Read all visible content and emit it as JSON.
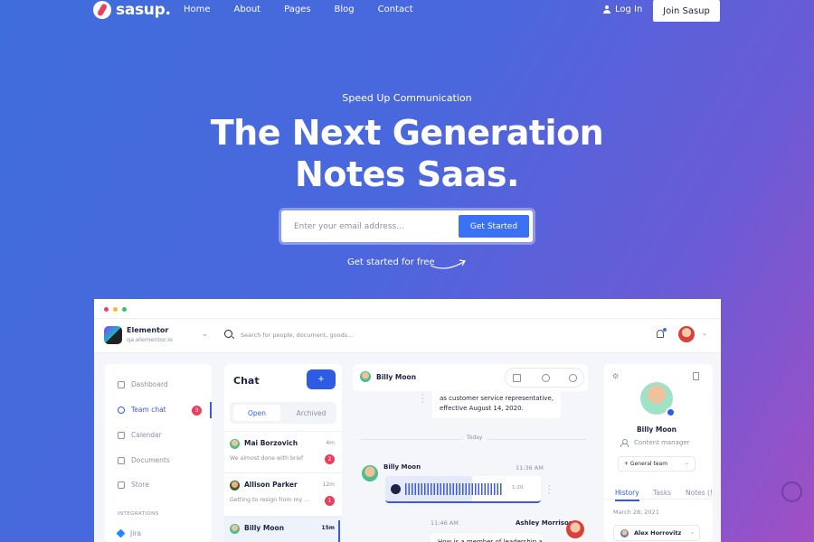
{
  "brand": {
    "name": "sasup."
  },
  "nav": {
    "links": [
      "Home",
      "About",
      "Pages",
      "Blog",
      "Contact"
    ],
    "login": "Log In",
    "join": "Join Sasup"
  },
  "hero": {
    "kicker": "Speed Up Communication",
    "headline_line1": "The Next Generation",
    "headline_line2": "Notes Saas.",
    "email_placeholder": "Enter your email address...",
    "cta": "Get Started",
    "free_text": "Get started for free"
  },
  "app": {
    "workspace": {
      "name": "Elementor",
      "sub": "qa.elementor.io"
    },
    "search_placeholder": "Search for people, document, goods...",
    "sidebar": {
      "items": [
        {
          "label": "Dashboard",
          "icon": "grid-icon"
        },
        {
          "label": "Team chat",
          "icon": "chat-icon",
          "badge": "3"
        },
        {
          "label": "Calendar",
          "icon": "calendar-icon"
        },
        {
          "label": "Documents",
          "icon": "folder-icon"
        },
        {
          "label": "Store",
          "icon": "bag-icon"
        }
      ],
      "section": "INTEGRATIONS",
      "integration": "Jira"
    },
    "chat": {
      "title": "Chat",
      "add": "+",
      "tabs": [
        "Open",
        "Archived"
      ],
      "conversations": [
        {
          "name": "Mai Borzovich",
          "time": "4m",
          "preview": "We almost done with brief",
          "count": "2"
        },
        {
          "name": "Allison Parker",
          "time": "12m",
          "preview": "Getting to resign from my ...",
          "count": "1"
        },
        {
          "name": "Billy Moon",
          "time": "15m",
          "preview": ""
        }
      ]
    },
    "thread": {
      "contact": "Billy Moon",
      "message1_line1": "as customer service representative,",
      "message1_line2": "effective August 14, 2020.",
      "divider": "Today",
      "voice": {
        "sender": "Billy Moon",
        "time": "11:36 AM",
        "duration": "1:20"
      },
      "message2": {
        "time": "11:46 AM",
        "sender": "Ashley Morrison",
        "text": "How is a member of leadership a"
      }
    },
    "profile": {
      "name": "Billy Moon",
      "role": "Content manager",
      "team": "+ General team",
      "tabs": [
        "History",
        "Tasks",
        "Notes (!"
      ],
      "date": "March 28, 2021",
      "entry": "Alex Horrovitz"
    }
  },
  "colors": {
    "accent": "#3b72f5",
    "primary": "#2d5be3",
    "danger": "#ef3e5c",
    "text_dark": "#1d2340"
  }
}
